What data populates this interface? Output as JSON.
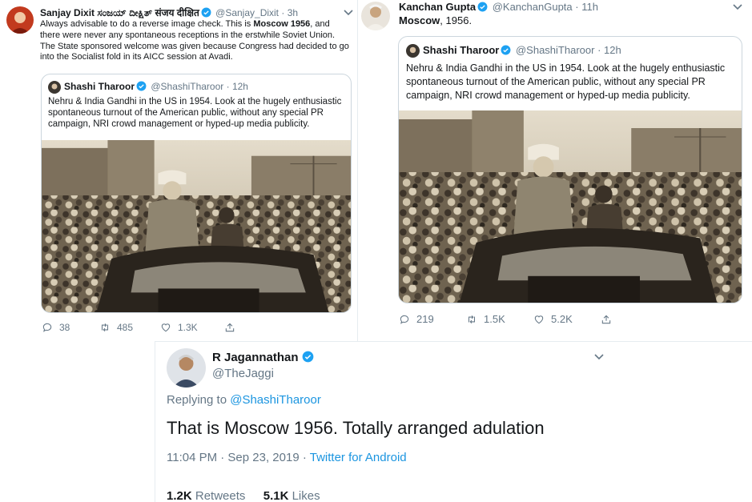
{
  "tweet1": {
    "author_name": "Sanjay Dixit ಸಂಜಯ್ ದೀಕ್ಷಿತ್ संजय दीक्षित",
    "handle": "@Sanjay_Dixit",
    "time": "3h",
    "text_pre": "Always advisable to do a reverse image check. This is ",
    "text_bold": "Moscow 1956",
    "text_post": ", and there were never any spontaneous receptions in the erstwhile Soviet Union. The State sponsored welcome was given because Congress had decided to go into the Socialist fold in its AICC session at Avadi.",
    "quote": {
      "author_name": "Shashi Tharoor",
      "handle": "@ShashiTharoor",
      "time": "12h",
      "text": "Nehru & India Gandhi in the US in 1954. Look at the hugely enthusiastic spontaneous turnout of the American public, without any special PR campaign, NRI crowd management or hyped-up media publicity."
    },
    "actions": {
      "replies": "38",
      "retweets": "485",
      "likes": "1.3K"
    }
  },
  "tweet2": {
    "author_name": "Kanchan Gupta",
    "handle": "@KanchanGupta",
    "time": "11h",
    "text_bold": "Moscow",
    "text_post": ", 1956.",
    "quote": {
      "author_name": "Shashi Tharoor",
      "handle": "@ShashiTharoor",
      "time": "12h",
      "text": "Nehru & India Gandhi in the US in 1954. Look at the hugely enthusiastic spontaneous turnout of the American public, without any special PR campaign, NRI crowd management or hyped-up media publicity."
    },
    "actions": {
      "replies": "219",
      "retweets": "1.5K",
      "likes": "5.2K"
    }
  },
  "tweet3": {
    "author_name": "R Jagannathan",
    "handle": "@TheJaggi",
    "replying_label": "Replying to ",
    "replying_to": "@ShashiTharoor",
    "text": "That is Moscow 1956. Totally arranged adulation",
    "timestamp": "11:04 PM · Sep 23, 2019 · ",
    "source": "Twitter for Android",
    "retweets_count": "1.2K",
    "retweets_label": "Retweets",
    "likes_count": "5.1K",
    "likes_label": "Likes"
  },
  "colors": {
    "accent": "#1b95e0",
    "muted": "#657786",
    "text": "#14171a",
    "border": "#ccd6dd"
  }
}
